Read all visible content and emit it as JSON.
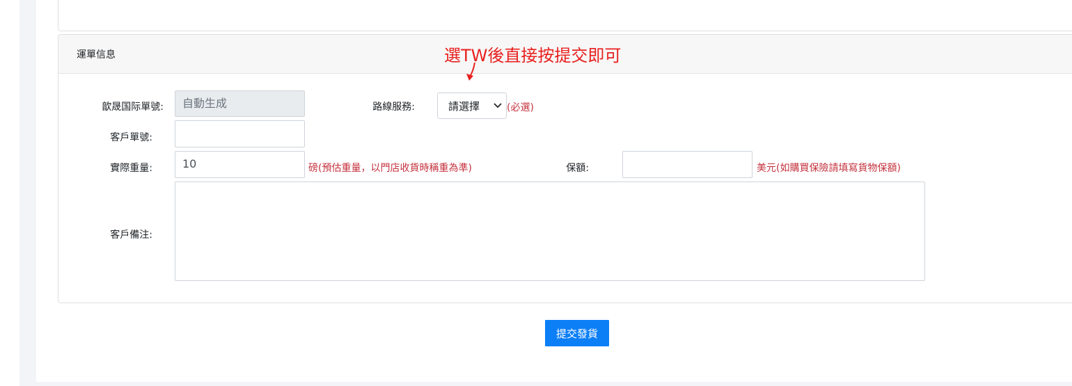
{
  "section": {
    "title": "運單信息",
    "annotation": "選TW後直接按提交即可"
  },
  "form": {
    "intl_no": {
      "label": "歆晟国际單號:",
      "value": "自動生成"
    },
    "route": {
      "label": "路線服務:",
      "selected": "請選擇",
      "hint": "(必選)"
    },
    "customer_no": {
      "label": "客戶單號:",
      "value": ""
    },
    "weight": {
      "label": "實際重量:",
      "value": "10",
      "hint": "磅(預估重量，以門店收貨時稱重為準)"
    },
    "insurance": {
      "label": "保額:",
      "value": "",
      "hint": "美元(如購買保險請填寫貨物保額)"
    },
    "remark": {
      "label": "客戶備注:",
      "value": ""
    }
  },
  "actions": {
    "submit_label": "提交發貨"
  },
  "colors": {
    "primary": "#0d7ff6",
    "hint": "#c4323e",
    "annotation": "#e8201f"
  }
}
